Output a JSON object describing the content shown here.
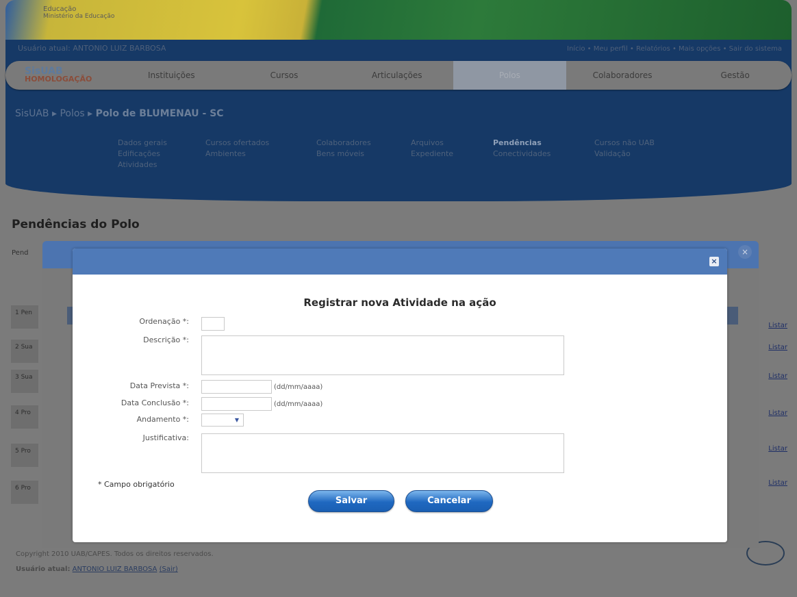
{
  "header": {
    "gov_line1": "Educação",
    "gov_line2": "Ministério da Educação",
    "user_line": "Usuário atual: ANTONIO LUIZ BARBOSA",
    "top_links": "Início • Meu perfil • Relatórios • Mais opções • Sair do sistema",
    "logo_top": "SisUAB",
    "logo_bottom": "HOMOLOGAÇÃO"
  },
  "nav": {
    "items": [
      "Instituições",
      "Cursos",
      "Articulações",
      "Polos",
      "Colaboradores",
      "Gestão"
    ],
    "active": "Polos"
  },
  "breadcrumb": {
    "a": "SisUAB",
    "b": "Polos",
    "c": "Polo de BLUMENAU - SC"
  },
  "subnav": [
    "Dados gerais",
    "Cursos ofertados",
    "Colaboradores",
    "Arquivos",
    "Pendências",
    "Cursos não UAB",
    "Edificações",
    "Ambientes",
    "Bens móveis",
    "Expediente",
    "Conectividades",
    "Validação",
    "Atividades"
  ],
  "subnav_active": "Pendências",
  "page": {
    "title": "Pendências do Polo",
    "side_text": "Pend",
    "row_link": "Listar"
  },
  "bg_rows": [
    "1 Pen",
    "2 Sua",
    "3 Sua",
    "4 Pro",
    "5 Pro",
    "6 Pro"
  ],
  "dialog": {
    "title": "Registrar nova Atividade na ação",
    "close_symbol": "×",
    "fields": {
      "ordenacao_label": "Ordenação *:",
      "descricao_label": "Descrição *:",
      "data_prevista_label": "Data Prevista *:",
      "data_conclusao_label": "Data Conclusão *:",
      "andamento_label": "Andamento *:",
      "justificativa_label": "Justificativa:",
      "date_hint": "(dd/mm/aaaa)",
      "ordenacao_value": "",
      "descricao_value": "",
      "data_prevista_value": "",
      "data_conclusao_value": "",
      "andamento_value": "",
      "justificativa_value": ""
    },
    "required_note": "* Campo obrigatório",
    "save_label": "Salvar",
    "cancel_label": "Cancelar"
  },
  "footer": {
    "copyright": "Copyright 2010 UAB/CAPES. Todos os direitos reservados.",
    "user_prefix": "Usuário atual:",
    "user_name": "ANTONIO LUIZ BARBOSA",
    "exit": "(Sair)"
  },
  "colors": {
    "dialog_header": "#4f7ab8",
    "button": "#1f68c0",
    "overlay": "#7b7b7b"
  }
}
